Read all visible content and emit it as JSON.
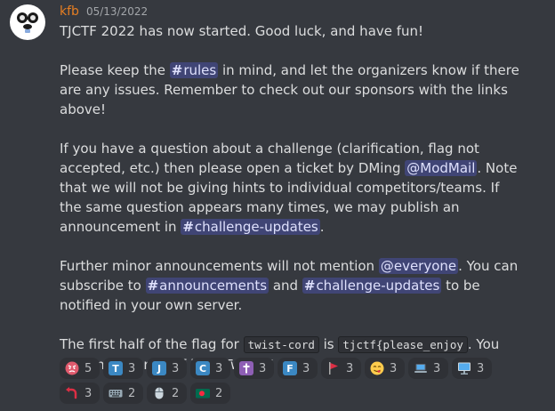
{
  "message": {
    "author": "kfb",
    "timestamp": "05/13/2022",
    "line1": "TJCTF 2022 has now started. Good luck, and have fun!",
    "p2": {
      "pre": "Please keep the ",
      "channel": "rules",
      "post": " in mind, and let the organizers know if there are any issues. Remember to check out our sponsors with the links above!"
    },
    "p3": {
      "pre": "If you have a question about a challenge (clarification, flag not accepted, etc.) then please open a ticket by DMing ",
      "mention": "@ModMail",
      "mid": ". Note that we will not be giving hints to individual competitors/teams. If the same question appears many times, we may publish an announcement in ",
      "channel": "challenge-updates",
      "post": "."
    },
    "p4": {
      "pre": "Further minor announcements will not mention ",
      "mention": "@everyone",
      "mid1": ". You can subscribe to ",
      "channel1": "announcements",
      "mid2": " and ",
      "channel2": "challenge-updates",
      "post": " to be notified in your own server."
    },
    "p5": {
      "pre": "The first half of the flag for ",
      "code1": "twist-cord",
      "mid": " is ",
      "code2": "tjctf{please_enjoy",
      "post": ". You can find the rest of it on Twitter!"
    }
  },
  "reactions": [
    {
      "icon": "angry-face-icon",
      "count": "5"
    },
    {
      "icon": "regional-t-icon",
      "letter": "T",
      "count": "3"
    },
    {
      "icon": "regional-j-icon",
      "letter": "J",
      "count": "3"
    },
    {
      "icon": "regional-c-icon",
      "letter": "C",
      "count": "3"
    },
    {
      "icon": "latin-cross-icon",
      "count": "3"
    },
    {
      "icon": "regional-f-icon",
      "letter": "F",
      "count": "3"
    },
    {
      "icon": "triangular-flag-icon",
      "count": "3"
    },
    {
      "icon": "yum-face-icon",
      "count": "3"
    },
    {
      "icon": "laptop-icon",
      "count": "3"
    },
    {
      "icon": "desktop-computer-icon",
      "count": "3"
    },
    {
      "icon": "curving-arrow-icon",
      "count": "3"
    },
    {
      "icon": "keyboard-icon",
      "count": "2"
    },
    {
      "icon": "mouse-icon",
      "count": "2"
    },
    {
      "icon": "bangladesh-flag-icon",
      "count": "2"
    }
  ],
  "colors": {
    "background": "#36393f",
    "username": "#e67e22",
    "mention_bg": "#414675",
    "reaction_bg": "#2f3136"
  }
}
